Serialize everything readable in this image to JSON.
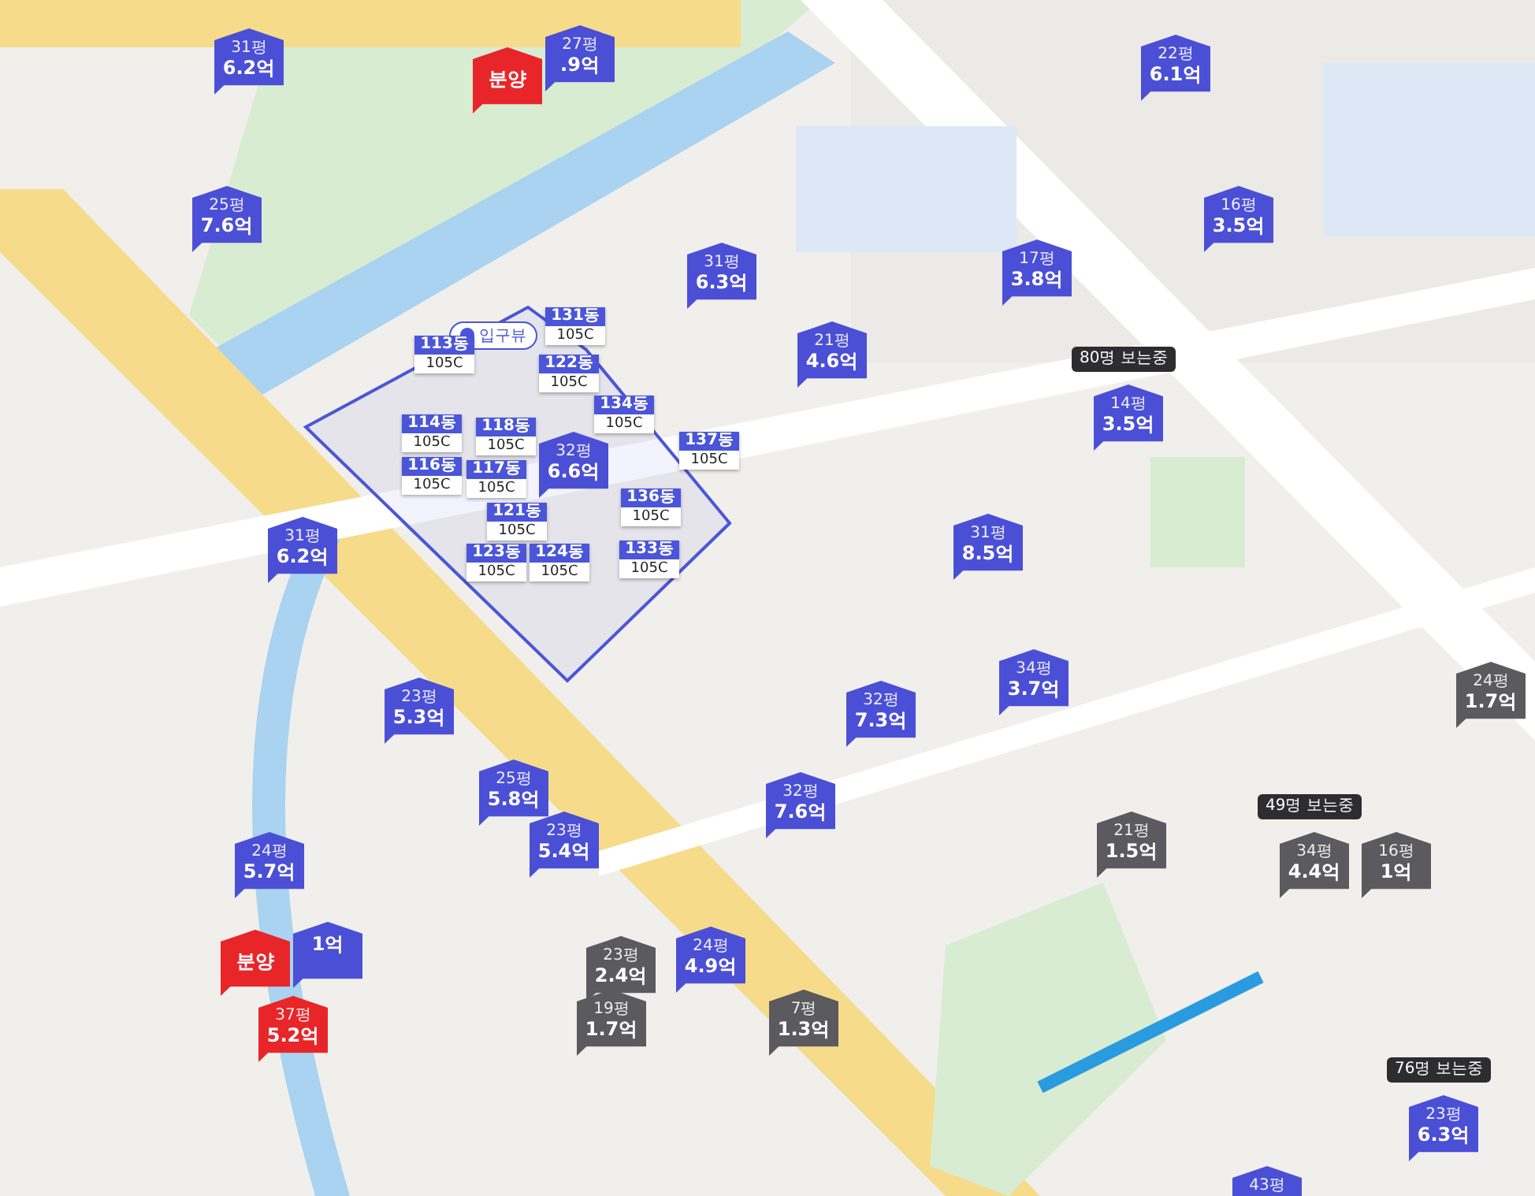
{
  "entrance_label": "입구뷰",
  "buildings": [
    {
      "name": "113동",
      "type": "105C"
    },
    {
      "name": "131동",
      "type": "105C"
    },
    {
      "name": "122동",
      "type": "105C"
    },
    {
      "name": "134동",
      "type": "105C"
    },
    {
      "name": "114동",
      "type": "105C"
    },
    {
      "name": "118동",
      "type": "105C"
    },
    {
      "name": "137동",
      "type": "105C"
    },
    {
      "name": "116동",
      "type": "105C"
    },
    {
      "name": "117동",
      "type": "105C"
    },
    {
      "name": "136동",
      "type": "105C"
    },
    {
      "name": "121동",
      "type": "105C"
    },
    {
      "name": "123동",
      "type": "105C"
    },
    {
      "name": "124동",
      "type": "105C"
    },
    {
      "name": "133동",
      "type": "105C"
    }
  ],
  "pins": [
    {
      "kind": "price",
      "color": "#4b4fd6",
      "area": "31평",
      "price": "6.2억"
    },
    {
      "kind": "price",
      "color": "#4b4fd6",
      "area": "27평",
      "price": ".9억"
    },
    {
      "kind": "sale",
      "color": "#e8262a",
      "price": "분양"
    },
    {
      "kind": "price",
      "color": "#4b4fd6",
      "area": "25평",
      "price": "7.6억"
    },
    {
      "kind": "price",
      "color": "#4b4fd6",
      "area": "22평",
      "price": "6.1억"
    },
    {
      "kind": "price",
      "color": "#4b4fd6",
      "area": "16평",
      "price": "3.5억"
    },
    {
      "kind": "price",
      "color": "#4b4fd6",
      "area": "31평",
      "price": "6.3억"
    },
    {
      "kind": "price",
      "color": "#4b4fd6",
      "area": "17평",
      "price": "3.8억"
    },
    {
      "kind": "price",
      "color": "#4b4fd6",
      "area": "21평",
      "price": "4.6억"
    },
    {
      "kind": "price",
      "color": "#4b4fd6",
      "area": "14평",
      "price": "3.5억",
      "viewers": "80명 보는중"
    },
    {
      "kind": "price",
      "color": "#4b4fd6",
      "area": "32평",
      "price": "6.6억"
    },
    {
      "kind": "price",
      "color": "#4b4fd6",
      "area": "31평",
      "price": "6.2억"
    },
    {
      "kind": "price",
      "color": "#4b4fd6",
      "area": "31평",
      "price": "8.5억"
    },
    {
      "kind": "price",
      "color": "#4b4fd6",
      "area": "34평",
      "price": "3.7억"
    },
    {
      "kind": "price",
      "color": "#4b4fd6",
      "area": "23평",
      "price": "5.3억"
    },
    {
      "kind": "price",
      "color": "#4b4fd6",
      "area": "32평",
      "price": "7.3억"
    },
    {
      "kind": "price",
      "color": "#4b4fd6",
      "area": "25평",
      "price": "5.8억"
    },
    {
      "kind": "price",
      "color": "#4b4fd6",
      "area": "32평",
      "price": "7.6억"
    },
    {
      "kind": "price",
      "color": "#4b4fd6",
      "area": "23평",
      "price": "5.4억"
    },
    {
      "kind": "price",
      "color": "#4b4fd6",
      "area": "24평",
      "price": "5.7억"
    },
    {
      "kind": "sale",
      "color": "#e8262a",
      "price": "분양"
    },
    {
      "kind": "price",
      "color": "#4b4fd6",
      "price": "1억"
    },
    {
      "kind": "price",
      "color": "#5a5a5f",
      "area": "23평",
      "price": "2.4억"
    },
    {
      "kind": "price",
      "color": "#4b4fd6",
      "area": "24평",
      "price": "4.9억"
    },
    {
      "kind": "price",
      "color": "#e8262a",
      "area": "37평",
      "price": "5.2억"
    },
    {
      "kind": "price",
      "color": "#5a5a5f",
      "area": "19평",
      "price": "1.7억"
    },
    {
      "kind": "price",
      "color": "#5a5a5f",
      "area": "7평",
      "price": "1.3억"
    },
    {
      "kind": "price",
      "color": "#5a5a5f",
      "area": "21평",
      "price": "1.5억"
    },
    {
      "kind": "price",
      "color": "#5a5a5f",
      "area": "34평",
      "price": "4.4억",
      "viewers": "49명 보는중"
    },
    {
      "kind": "price",
      "color": "#5a5a5f",
      "area": "16평",
      "price": "1억"
    },
    {
      "kind": "price",
      "color": "#5a5a5f",
      "area": "24평",
      "price": "1.7억"
    },
    {
      "kind": "price",
      "color": "#4b4fd6",
      "area": "23평",
      "price": "6.3억",
      "viewers": "76명 보는중"
    },
    {
      "kind": "price",
      "color": "#4b4fd6",
      "area": "43평"
    }
  ]
}
